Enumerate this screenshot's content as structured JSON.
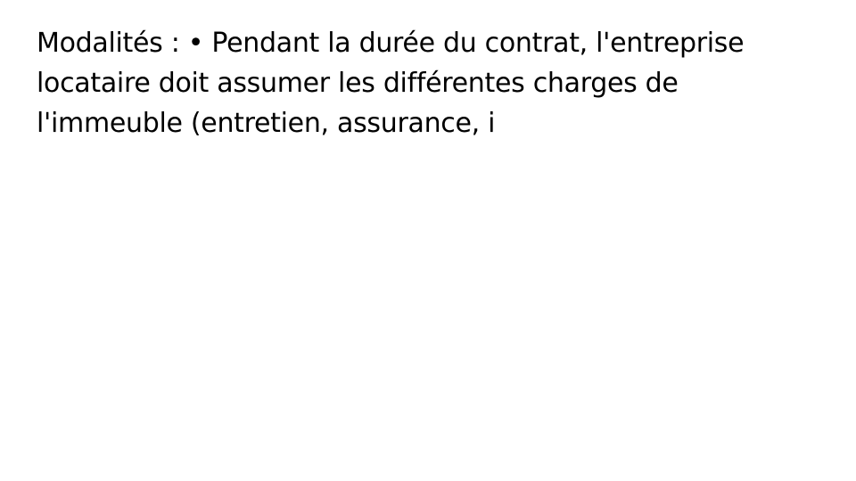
{
  "slide": {
    "lines": [
      "Modalités : • Pendant la durée du contrat, l'entreprise",
      "locataire doit assumer les différentes charges de",
      "l'immeuble (entretien, assurance, i"
    ]
  }
}
